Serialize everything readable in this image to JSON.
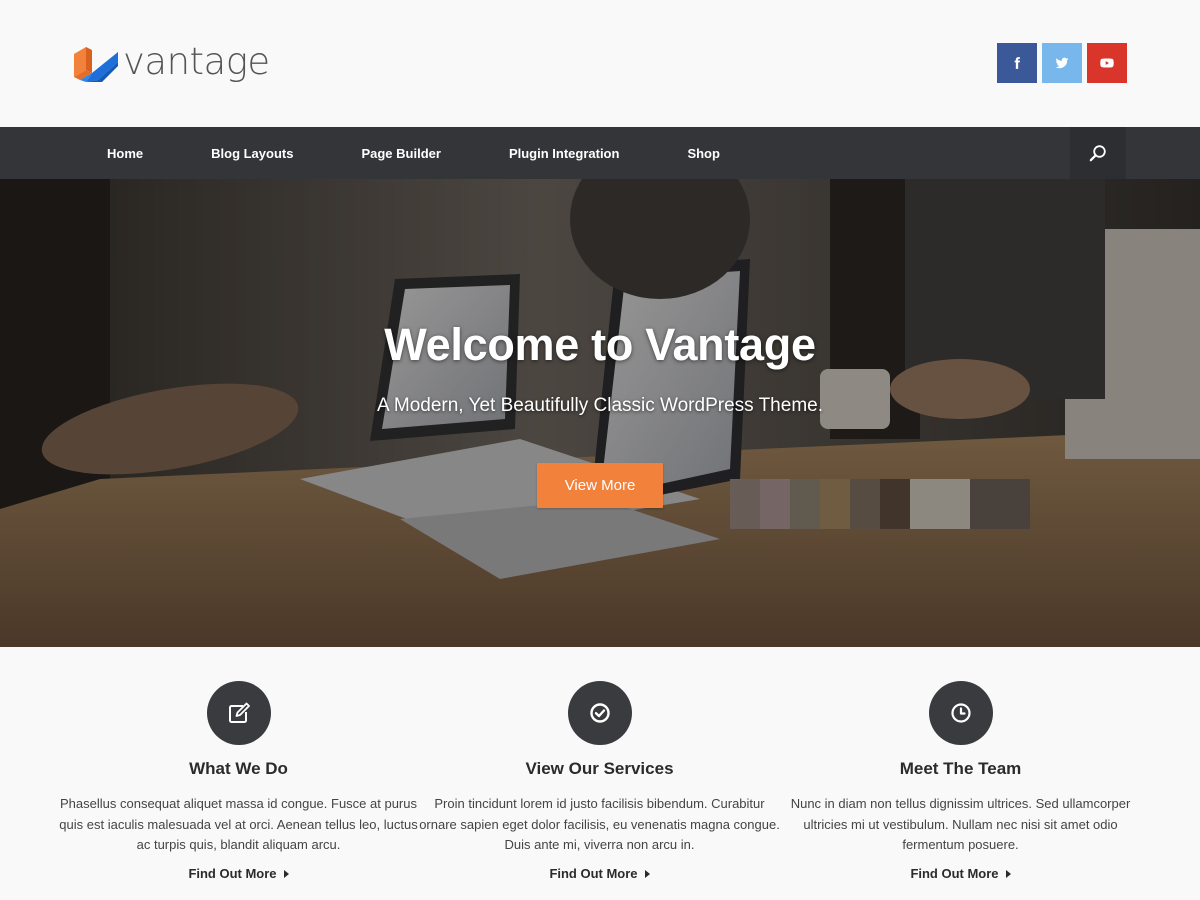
{
  "brand": {
    "name": "vantage",
    "logo_icon": "vantage-logo-icon",
    "logo_colors": [
      "#f2813b",
      "#1e6fd9"
    ]
  },
  "social": [
    {
      "name": "facebook",
      "icon": "facebook-icon",
      "color": "#3b5998"
    },
    {
      "name": "twitter",
      "icon": "twitter-icon",
      "color": "#78b7ec"
    },
    {
      "name": "youtube",
      "icon": "youtube-icon",
      "color": "#d9352b"
    }
  ],
  "nav": {
    "items": [
      "Home",
      "Blog Layouts",
      "Page Builder",
      "Plugin Integration",
      "Shop"
    ],
    "search_icon": "search-icon",
    "background": "#343538"
  },
  "hero": {
    "title": "Welcome to Vantage",
    "subtitle": "A Modern, Yet Beautifully Classic WordPress Theme.",
    "button": "View More",
    "button_color": "#f2813b"
  },
  "features": [
    {
      "icon": "edit-icon",
      "title": "What We Do",
      "text": "Phasellus consequat aliquet massa id congue. Fusce at purus quis est iaculis malesuada vel at orci. Aenean tellus leo, luctus ac turpis quis, blandit aliquam arcu.",
      "link": "Find Out More"
    },
    {
      "icon": "check-circle-icon",
      "title": "View Our Services",
      "text": "Proin tincidunt lorem id justo facilisis bibendum. Curabitur ornare sapien eget dolor facilisis, eu venenatis magna congue. Duis ante mi, viverra non arcu in.",
      "link": "Find Out More"
    },
    {
      "icon": "clock-icon",
      "title": "Meet The Team",
      "text": "Nunc in diam non tellus dignissim ultrices. Sed ullamcorper ultricies mi ut vestibulum. Nullam nec nisi sit amet odio fermentum posuere.",
      "link": "Find Out More"
    }
  ]
}
